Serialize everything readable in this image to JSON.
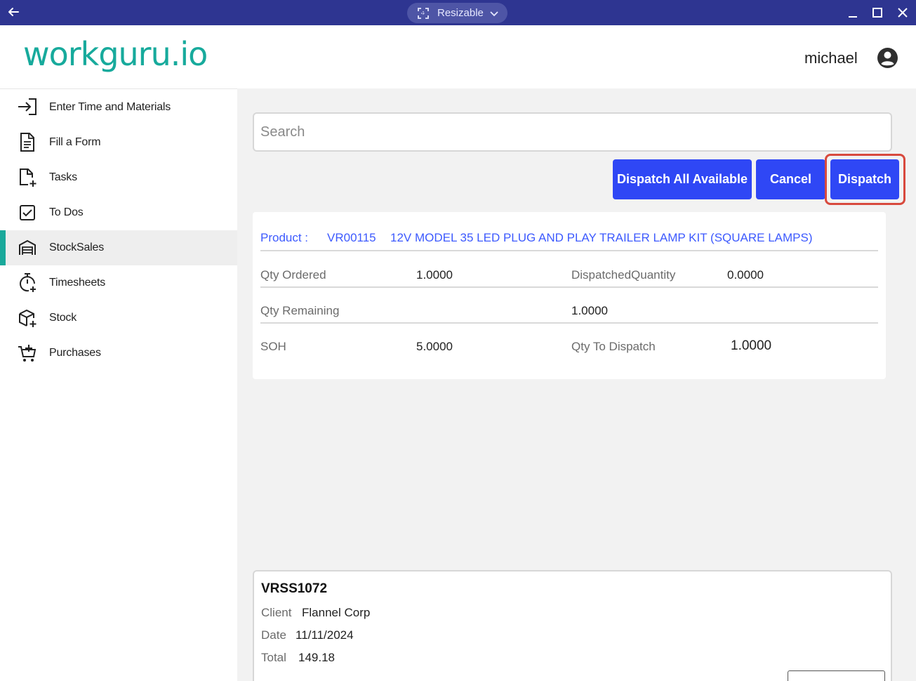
{
  "window": {
    "mode_label": "Resizable",
    "icons": [
      "back-arrow-icon",
      "resize-icon",
      "chevron-down-icon",
      "minimize-icon",
      "maximize-icon",
      "close-icon"
    ]
  },
  "header": {
    "logo_text": "workguru.io",
    "user_name": "michael",
    "brand_color": "#17aa9c"
  },
  "sidebar": {
    "items": [
      {
        "label": "Enter Time and Materials",
        "icon": "login-arrow-icon"
      },
      {
        "label": "Fill a Form",
        "icon": "document-icon"
      },
      {
        "label": "Tasks",
        "icon": "task-add-icon"
      },
      {
        "label": "To Dos",
        "icon": "checkbox-icon"
      },
      {
        "label": "StockSales",
        "icon": "warehouse-icon",
        "active": true
      },
      {
        "label": "Timesheets",
        "icon": "stopwatch-add-icon"
      },
      {
        "label": "Stock",
        "icon": "box-add-icon"
      },
      {
        "label": "Purchases",
        "icon": "cart-add-icon"
      }
    ]
  },
  "search": {
    "placeholder": "Search",
    "value": ""
  },
  "actions": {
    "dispatch_all_label": "Dispatch All Available",
    "cancel_label": "Cancel",
    "dispatch_label": "Dispatch",
    "button_color": "#2f47f5",
    "highlight_color": "#d84a3e"
  },
  "product": {
    "prefix": "Product :",
    "code": "VR00115",
    "name": "12V MODEL 35 LED PLUG AND PLAY TRAILER LAMP KIT (SQUARE LAMPS)",
    "qty_ordered_label": "Qty Ordered",
    "qty_ordered": "1.0000",
    "dispatched_label": "DispatchedQuantity",
    "dispatched": "0.0000",
    "qty_remaining_label": "Qty Remaining",
    "qty_remaining": "1.0000",
    "soh_label": "SOH",
    "soh": "5.0000",
    "qty_to_dispatch_label": "Qty To Dispatch",
    "qty_to_dispatch": "1.0000"
  },
  "order": {
    "number": "VRSS1072",
    "client_label": "Client",
    "client": "Flannel Corp",
    "date_label": "Date",
    "date": "11/11/2024",
    "total_label": "Total",
    "total": "149.18"
  }
}
